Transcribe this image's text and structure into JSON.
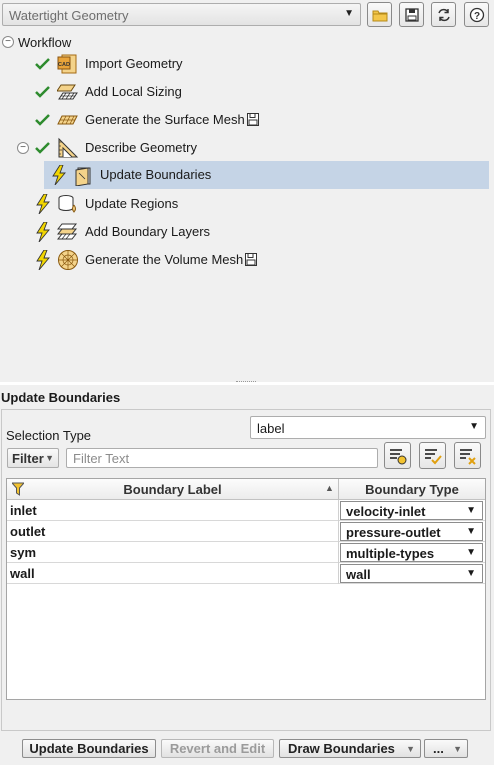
{
  "toolbar": {
    "workflow_select_value": "Watertight Geometry",
    "icons": [
      "open-folder-icon",
      "save-icon",
      "refresh-icon",
      "help-icon"
    ],
    "help_glyph": "?"
  },
  "workflow": {
    "root_label": "Workflow",
    "items": [
      {
        "label": "Import Geometry",
        "status": "done",
        "icon": "cad-import-icon",
        "save": false
      },
      {
        "label": "Add Local Sizing",
        "status": "done",
        "icon": "sizing-grid-icon",
        "save": false
      },
      {
        "label": "Generate the Surface Mesh",
        "status": "done",
        "icon": "surface-mesh-icon",
        "save": true
      },
      {
        "label": "Describe Geometry",
        "status": "done",
        "icon": "geometry-triangle-icon",
        "save": false
      },
      {
        "label": "Update Boundaries",
        "status": "pending",
        "icon": "boundaries-panel-icon",
        "save": false,
        "selected": true
      },
      {
        "label": "Update Regions",
        "status": "pending",
        "icon": "regions-cylinder-icon",
        "save": false
      },
      {
        "label": "Add Boundary Layers",
        "status": "pending",
        "icon": "boundary-layers-icon",
        "save": false
      },
      {
        "label": "Generate the Volume Mesh",
        "status": "pending",
        "icon": "volume-mesh-sphere-icon",
        "save": true
      }
    ]
  },
  "panel": {
    "title": "Update Boundaries",
    "selection_type_label": "Selection Type",
    "selection_type_value": "label",
    "filter_button_label": "Filter",
    "filter_placeholder": "Filter Text",
    "table": {
      "headers": [
        "Boundary Label",
        "Boundary Type"
      ],
      "rows": [
        {
          "label": "inlet",
          "type": "velocity-inlet"
        },
        {
          "label": "outlet",
          "type": "pressure-outlet"
        },
        {
          "label": "sym",
          "type": "multiple-types"
        },
        {
          "label": "wall",
          "type": "wall"
        }
      ]
    }
  },
  "bottom": {
    "update_label": "Update Boundaries",
    "revert_label": "Revert and Edit",
    "draw_label": "Draw Boundaries",
    "more_label": "..."
  },
  "colors": {
    "check_green": "#2e8b2e",
    "bolt_yellow": "#f2d600",
    "selection_blue": "#c5d4e6",
    "icon_orange": "#d08a1e"
  }
}
